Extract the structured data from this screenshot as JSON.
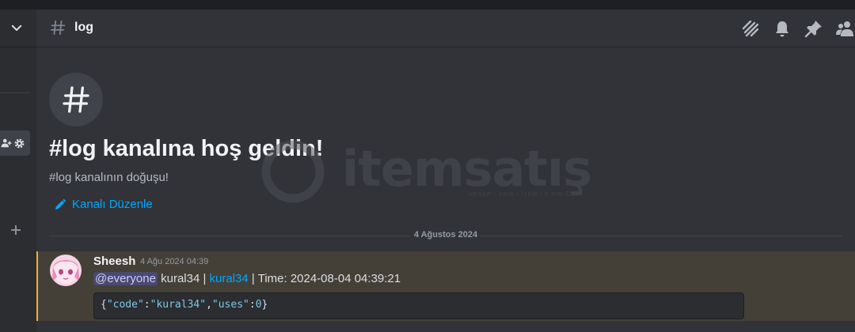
{
  "channel": {
    "name": "log"
  },
  "welcome": {
    "title": "#log kanalına hoş geldin!",
    "subtitle": "#log kanalının doğuşu!",
    "edit_label": "Kanalı Düzenle"
  },
  "watermark": {
    "brand": "itemsatış",
    "tagline": "HESAP / SKIN / ITEM / E-PIN",
    "domain": ".com"
  },
  "divider": {
    "date": "4 Ağustos 2024"
  },
  "message": {
    "author": "Sheesh",
    "timestamp": "4 Ağu 2024 04:39",
    "mention": "@everyone",
    "text_1": " kural34 | ",
    "link": "kural34",
    "text_2": " | Time: 2024-08-04 04:39:21",
    "code": {
      "open": "{",
      "key1": "\"code\"",
      "colon1": ":",
      "val1": "\"kural34\"",
      "comma": ",",
      "key2": "\"uses\"",
      "colon2": ":",
      "val2": "0",
      "close": "}"
    }
  },
  "icons": {
    "header": [
      "threads-icon",
      "bell-icon",
      "pin-icon",
      "members-icon"
    ]
  },
  "colors": {
    "background": "#313338",
    "sidebar": "#2b2d31",
    "link": "#00a8fc",
    "highlight_bg": "#444038",
    "highlight_bar": "#f0b232"
  }
}
